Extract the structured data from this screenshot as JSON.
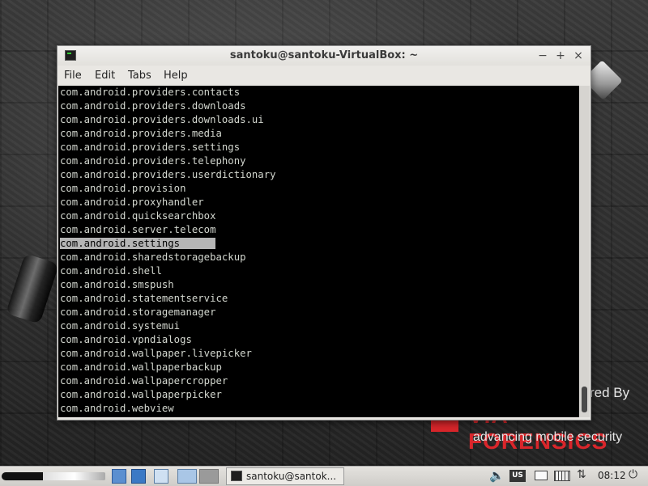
{
  "window": {
    "title": "santoku@santoku-VirtualBox: ~",
    "minimize_glyph": "−",
    "maximize_glyph": "+",
    "close_glyph": "×"
  },
  "menu": {
    "file": "File",
    "edit": "Edit",
    "tabs": "Tabs",
    "help": "Help"
  },
  "terminal": {
    "lines": [
      "com.android.providers.contacts",
      "com.android.providers.downloads",
      "com.android.providers.downloads.ui",
      "com.android.providers.media",
      "com.android.providers.settings",
      "com.android.providers.telephony",
      "com.android.providers.userdictionary",
      "com.android.provision",
      "com.android.proxyhandler",
      "com.android.quicksearchbox",
      "com.android.server.telecom",
      "com.android.settings",
      "com.android.sharedstoragebackup",
      "com.android.shell",
      "com.android.smspush",
      "com.android.statementservice",
      "com.android.storagemanager",
      "com.android.systemui",
      "com.android.vpndialogs",
      "com.android.wallpaper.livepicker",
      "com.android.wallpaperbackup",
      "com.android.wallpapercropper",
      "com.android.wallpaperpicker",
      "com.android.webview"
    ],
    "selected_index": 11,
    "colors": {
      "background": "#000000",
      "foreground": "#d3d7cf",
      "selection": "#b5b5b5"
    }
  },
  "wallpaper": {
    "powered_by": "red By",
    "brand": "VIA FORENSICS",
    "tagline": "advancing mobile security",
    "brand_color": "#d9262b"
  },
  "taskbar": {
    "task_label": "santoku@santok...",
    "keyboard_layout": "US",
    "clock": "08:12",
    "volume_glyph": "🔈",
    "network_glyph": "⇅",
    "power_glyph": "⏻"
  }
}
